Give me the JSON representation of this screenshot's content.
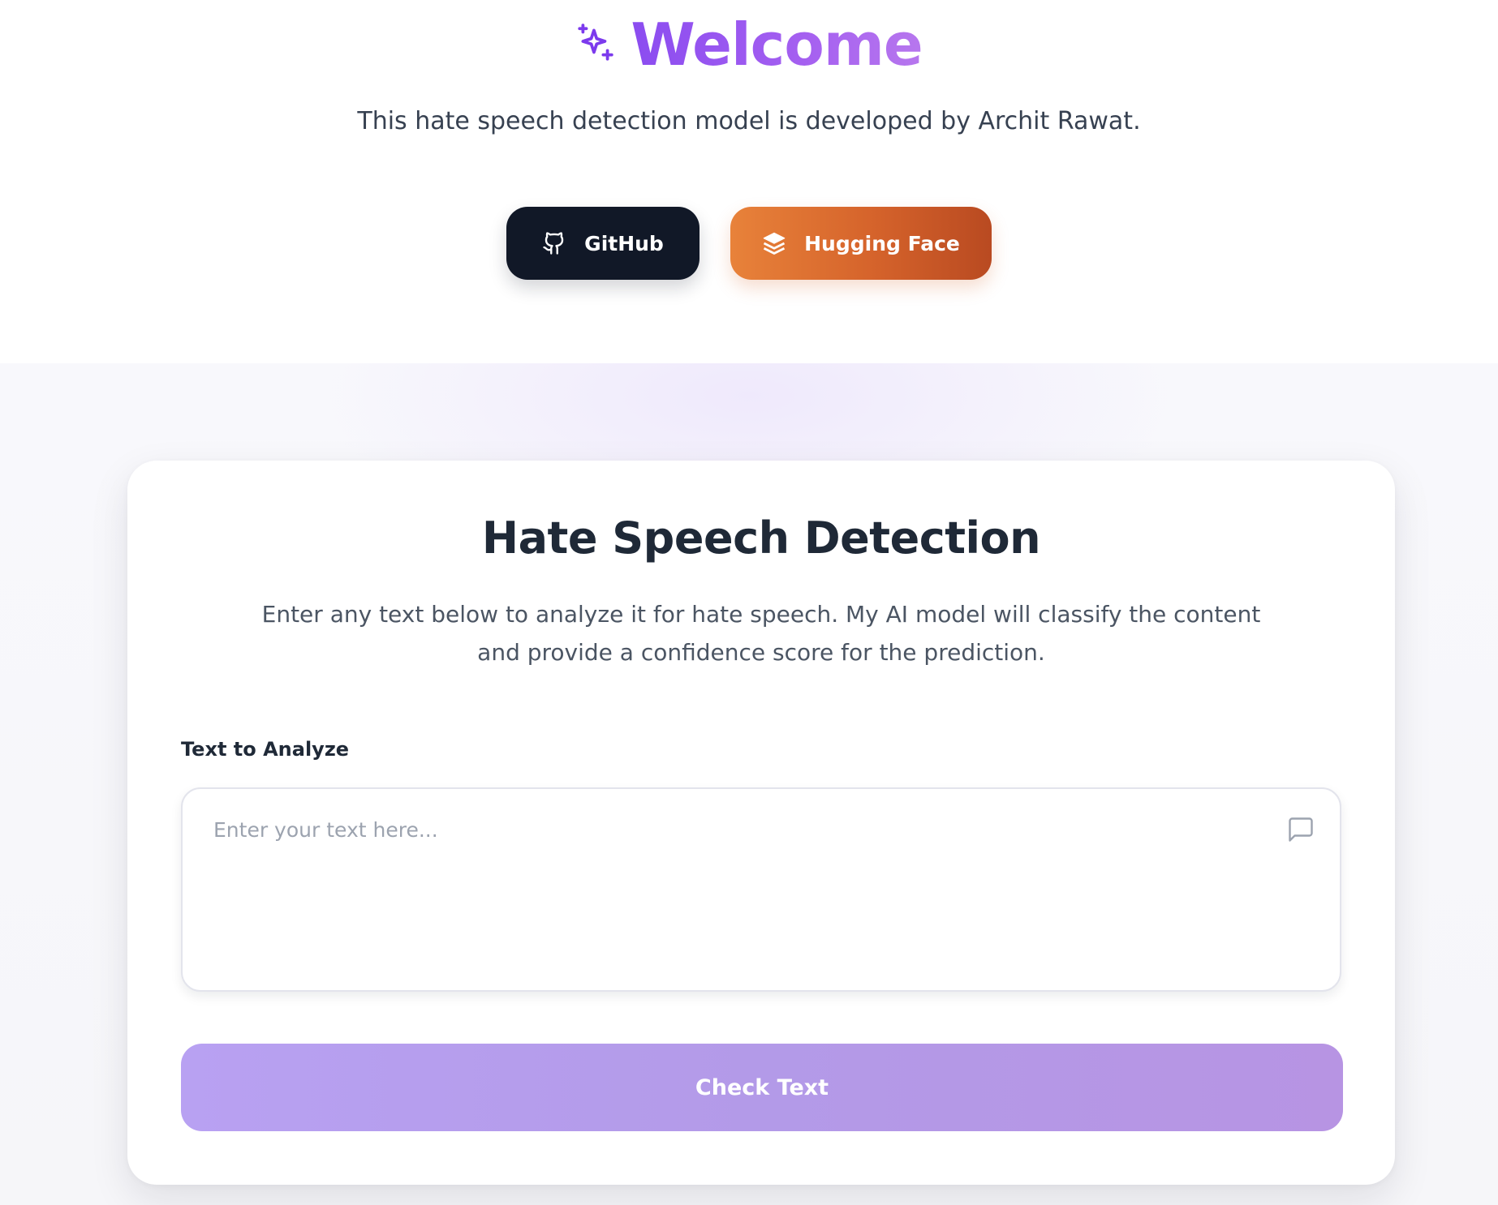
{
  "hero": {
    "title": "Welcome",
    "subtitle": "This hate speech detection model is developed by Archit Rawat.",
    "buttons": {
      "github_label": "GitHub",
      "huggingface_label": "Hugging Face"
    },
    "icons": {
      "title_icon": "sparkles-icon",
      "github_icon": "github-icon",
      "huggingface_icon": "layers-icon"
    }
  },
  "card": {
    "title": "Hate Speech Detection",
    "description": "Enter any text below to analyze it for hate speech. My AI model will classify the content and provide a confidence score for the prediction.",
    "field_label": "Text to Analyze",
    "input": {
      "value": "",
      "placeholder": "Enter your text here..."
    },
    "input_icon": "message-square-icon",
    "submit_label": "Check Text"
  },
  "colors": {
    "accent_purple": "#8b4cf0",
    "github_button": "#111827",
    "huggingface_orange": "#e8823a",
    "check_button": "#b8a1f2"
  }
}
